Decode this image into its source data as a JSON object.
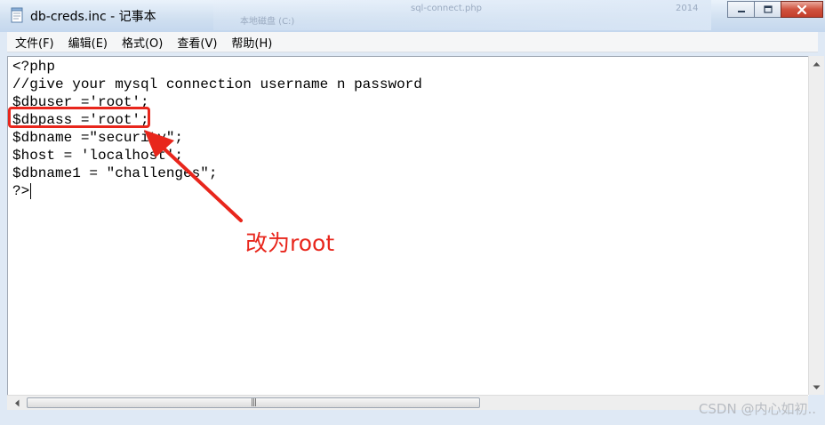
{
  "window": {
    "title": "db-creds.inc - 记事本"
  },
  "background_ghost": {
    "item1": "sql-connect.php",
    "item2": "本地磁盘 (C:)",
    "item3": "2014"
  },
  "menu": {
    "items": [
      "文件(F)",
      "编辑(E)",
      "格式(O)",
      "查看(V)",
      "帮助(H)"
    ]
  },
  "editor": {
    "lines": [
      "<?php",
      "//give your mysql connection username n password",
      "$dbuser ='root';",
      "$dbpass ='root';",
      "$dbname =\"security\";",
      "$host = 'localhost';",
      "$dbname1 = \"challenges\";",
      "?>"
    ]
  },
  "annotation": {
    "label": "改为root",
    "color": "#e8261c"
  },
  "watermark": "CSDN @内心如初.."
}
